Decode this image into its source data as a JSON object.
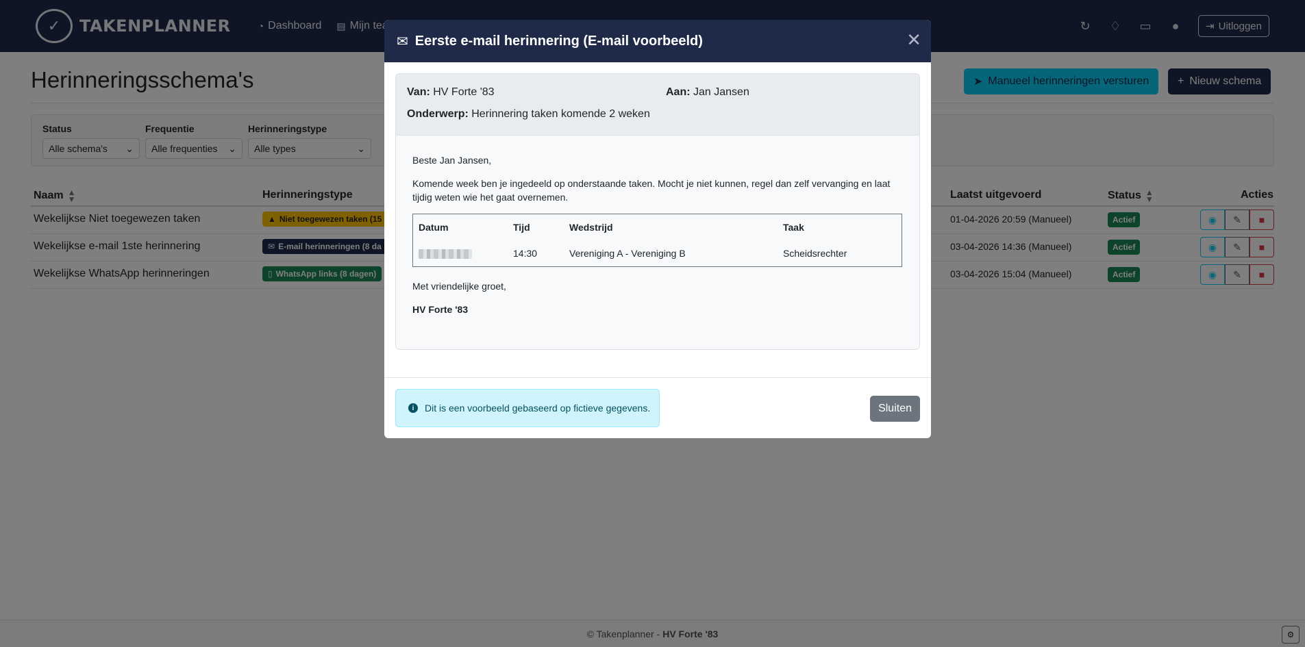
{
  "navbar": {
    "brand": "TAKENPLANNER",
    "links": [
      {
        "label": "Dashboard",
        "icon": "dashboard-icon"
      },
      {
        "label": "Mijn team ta",
        "icon": "clipboard-icon"
      }
    ],
    "logout_label": "Uitloggen"
  },
  "page": {
    "title": "Herinneringsschema's",
    "send_button": "Manueel herinneringen versturen",
    "new_button": "Nieuw schema"
  },
  "filters": [
    {
      "label": "Status",
      "value": "Alle schema's"
    },
    {
      "label": "Frequentie",
      "value": "Alle frequenties"
    },
    {
      "label": "Herinneringstype",
      "value": "Alle types"
    }
  ],
  "table": {
    "headers": {
      "naam": "Naam",
      "type": "Herinneringstype",
      "last": "Laatst uitgevoerd",
      "status": "Status",
      "actions": "Acties"
    },
    "rows": [
      {
        "name": "Wekelijkse Niet toegewezen taken",
        "type": "Niet toegewezen taken (15",
        "type_icon": "warning-icon",
        "type_bg": "#ffc107",
        "type_fg": "#212529",
        "last": "01-04-2026 20:59 (Manueel)",
        "status": "Actief"
      },
      {
        "name": "Wekelijkse e-mail 1ste herinnering",
        "type": "E-mail herinneringen (8 da",
        "type_icon": "envelope-icon",
        "type_bg": "#1f2a48",
        "type_fg": "#ffffff",
        "last": "03-04-2026 14:36 (Manueel)",
        "status": "Actief"
      },
      {
        "name": "Wekelijkse WhatsApp herinneringen",
        "type": "WhatsApp links (8 dagen)",
        "type_icon": "phone-icon",
        "type_bg": "#198754",
        "type_fg": "#ffffff",
        "last": "03-04-2026 15:04 (Manueel)",
        "status": "Actief"
      }
    ]
  },
  "footer": {
    "prefix": "© Takenplanner - ",
    "club": "HV Forte '83"
  },
  "modal": {
    "title": "Eerste e-mail herinnering (E-mail voorbeeld)",
    "from_label": "Van:",
    "from_value": "HV Forte '83",
    "to_label": "Aan:",
    "to_value": "Jan Jansen",
    "subject_label": "Onderwerp:",
    "subject_value": "Herinnering taken komende 2 weken",
    "greeting": "Beste Jan Jansen,",
    "intro": "Komende week ben je ingedeeld op onderstaande taken. Mocht je niet kunnen, regel dan zelf vervanging en laat tijdig weten wie het gaat overnemen.",
    "task_table": {
      "headers": [
        "Datum",
        "Tijd",
        "Wedstrijd",
        "Taak"
      ],
      "row": {
        "tijd": "14:30",
        "wedstrijd": "Vereniging A - Vereniging B",
        "taak": "Scheidsrechter"
      }
    },
    "closing": "Met vriendelijke groet,",
    "signature": "HV Forte '83",
    "info": "Dit is een voorbeeld gebaseerd op fictieve gegevens.",
    "close_button": "Sluiten"
  },
  "colors": {
    "navbar": "#1f2a48",
    "accent": "#0dcaf0",
    "success": "#198754",
    "danger": "#dc3545"
  }
}
